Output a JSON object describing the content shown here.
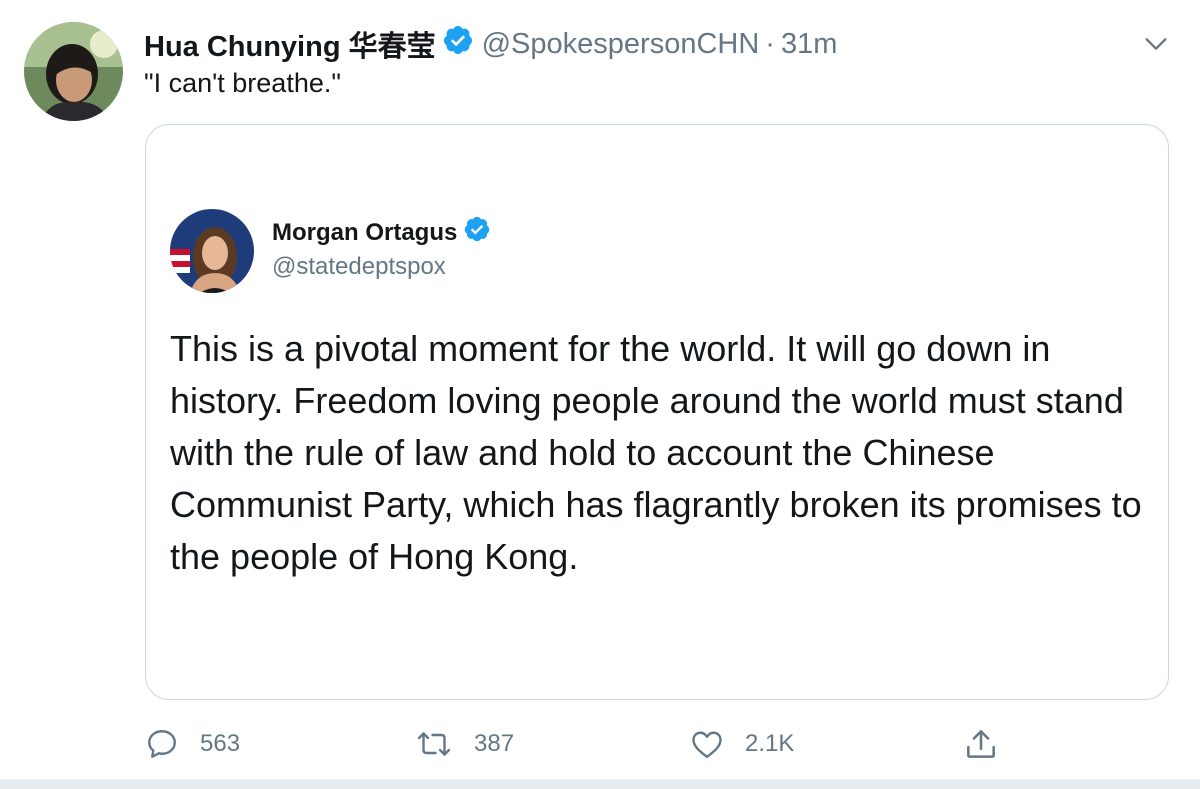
{
  "tweet": {
    "author": {
      "display_name": "Hua Chunying 华春莹",
      "handle": "@SpokespersonCHN",
      "separator": "·",
      "time": "31m",
      "verified": true
    },
    "text": "\"I can't breathe.\"",
    "menu_icon": "chevron-down-icon"
  },
  "quoted_tweet": {
    "author": {
      "display_name": "Morgan Ortagus",
      "handle": "@statedeptspox",
      "verified": true
    },
    "text": "This is a pivotal moment for the world. It will go down in history. Freedom loving people around the world must stand with the rule of law and hold to account the Chinese Communist Party, which has flagrantly broken its promises to the people of Hong Kong."
  },
  "actions": {
    "reply": {
      "icon": "reply-icon",
      "count": "563"
    },
    "retweet": {
      "icon": "retweet-icon",
      "count": "387"
    },
    "like": {
      "icon": "heart-icon",
      "count": "2.1K"
    },
    "share": {
      "icon": "share-icon"
    }
  },
  "colors": {
    "verified": "#1da1f2",
    "secondary_text": "#657786",
    "border": "#ccd6dd",
    "icon": "#657786"
  }
}
